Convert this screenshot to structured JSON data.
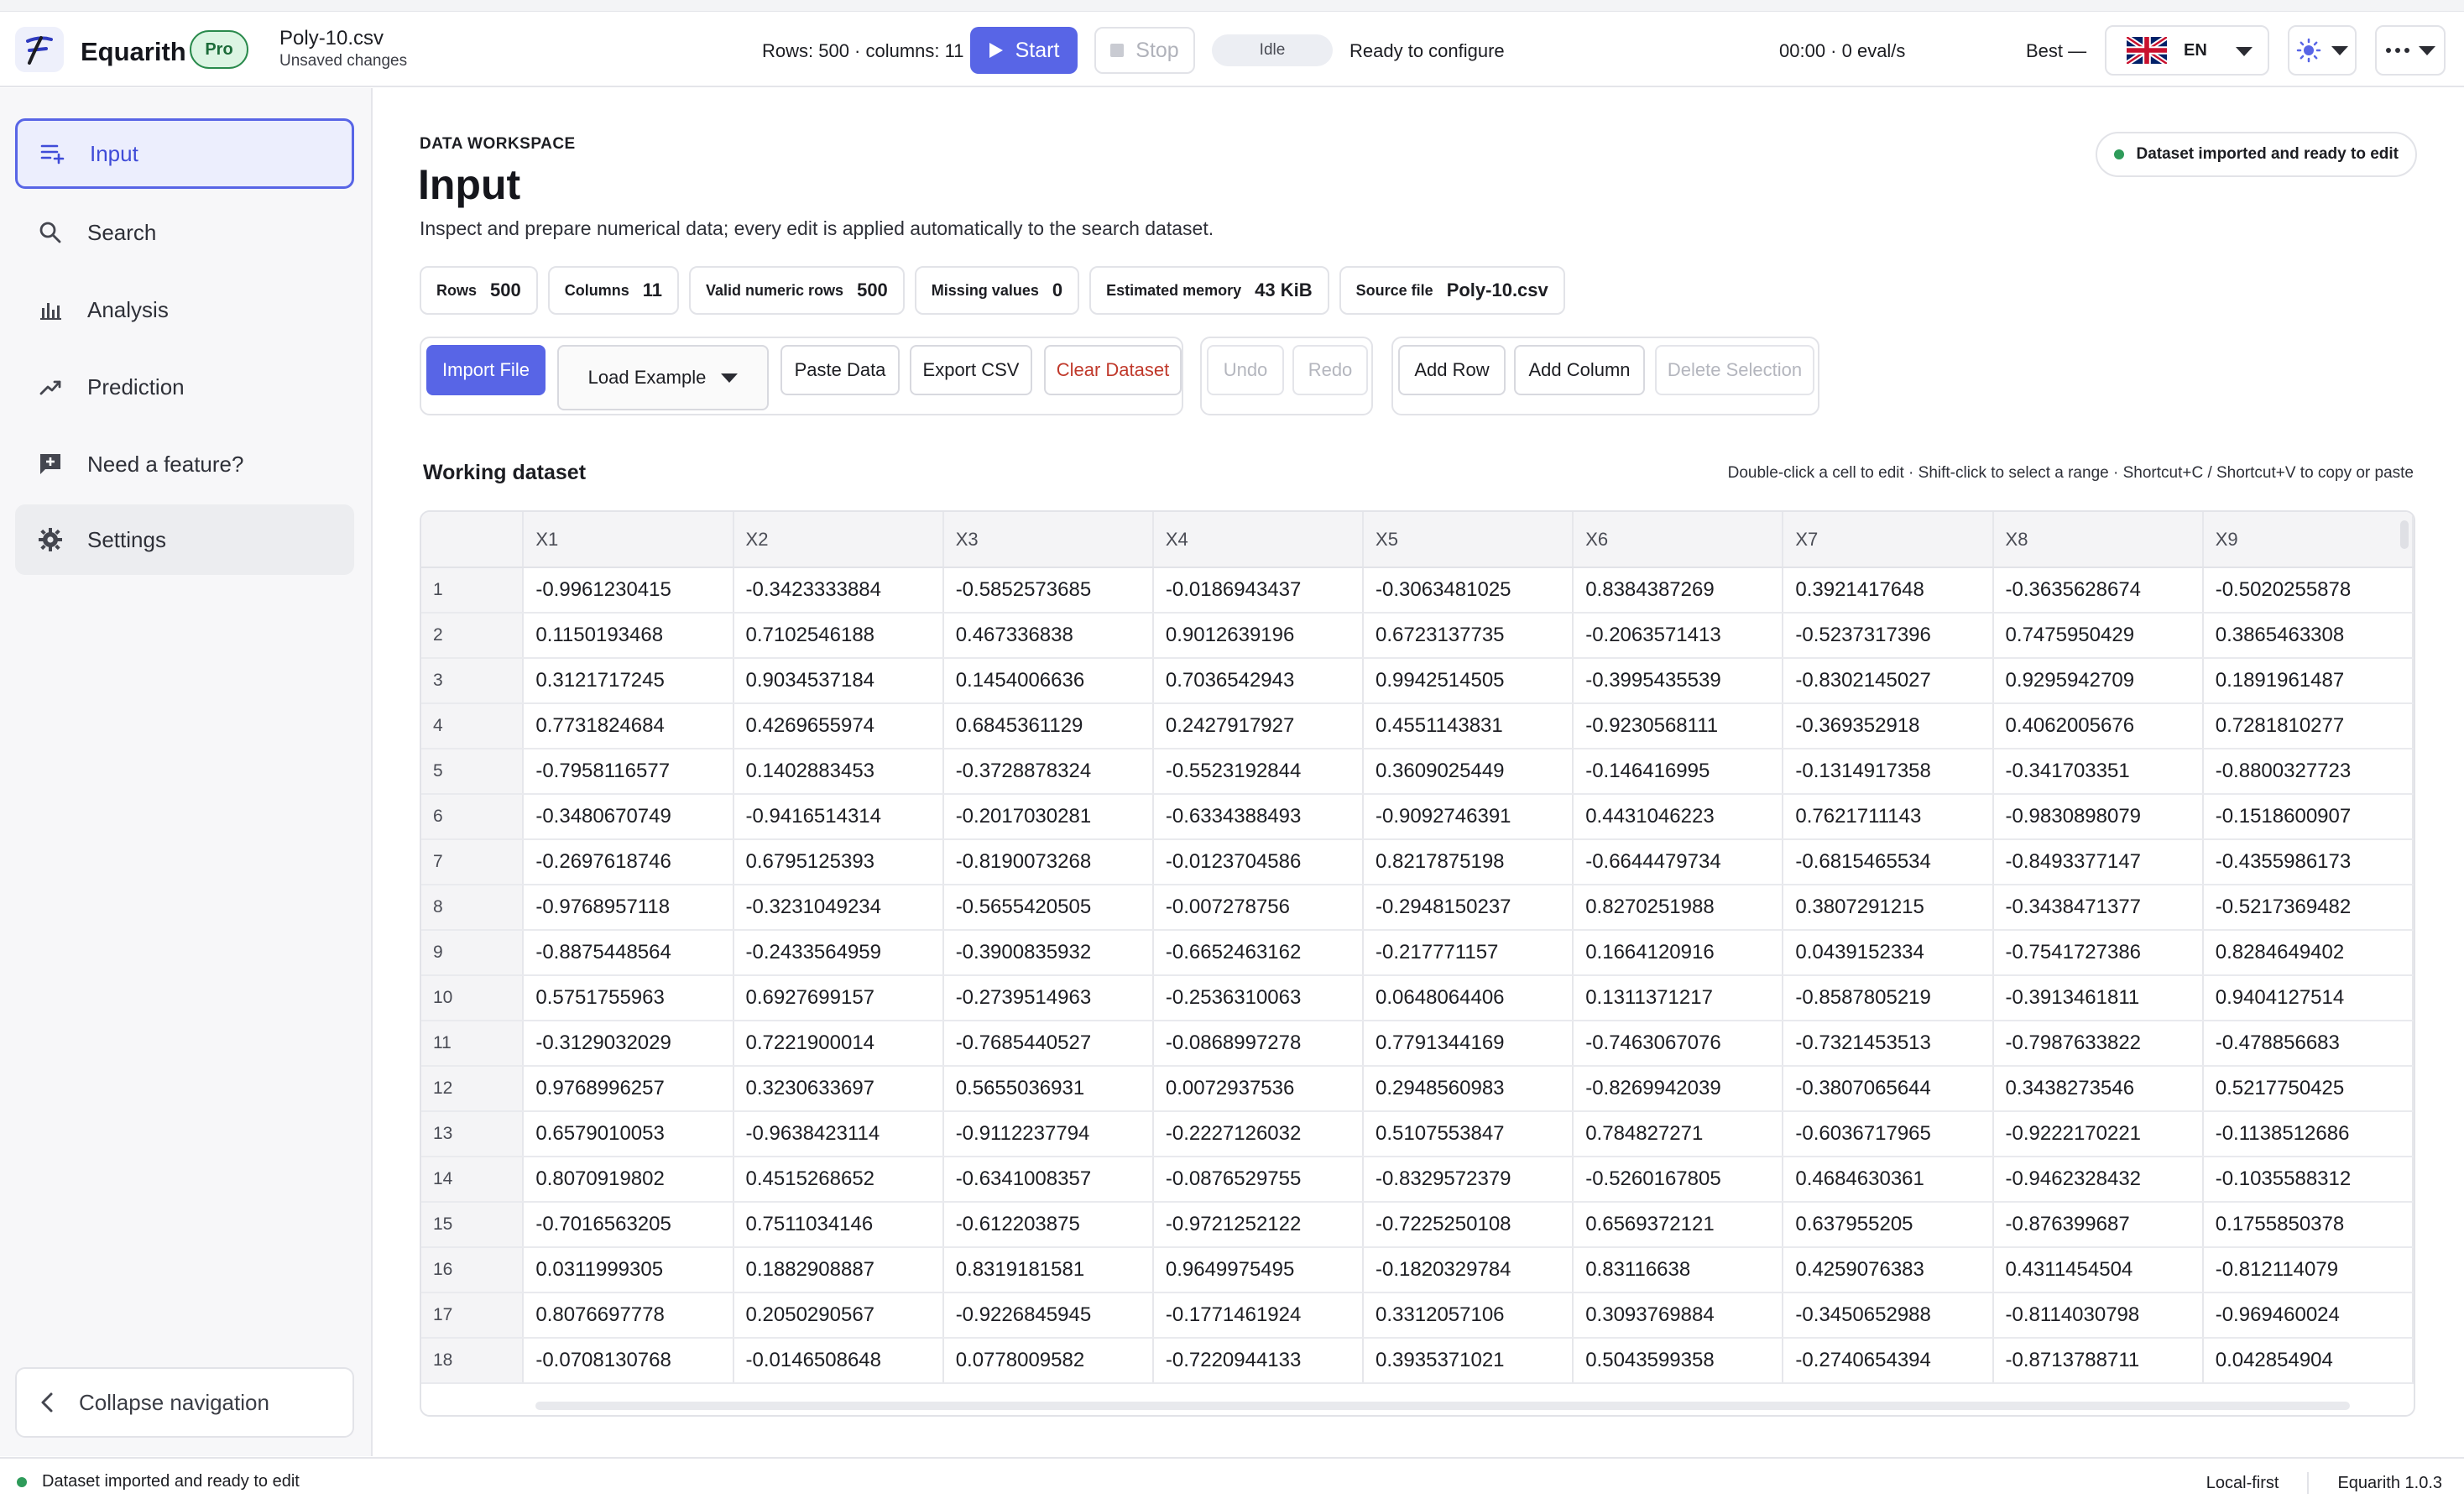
{
  "app": {
    "name": "Equarith",
    "badge": "Pro",
    "file_name": "Poly-10.csv",
    "file_status": "Unsaved changes",
    "version": "Equarith 1.0.3"
  },
  "header": {
    "rows_cols": "Rows: 500 · columns: 11",
    "start_label": "Start",
    "stop_label": "Stop",
    "run_state": "Idle",
    "ready_text": "Ready to configure",
    "timer": "00:00 · 0 eval/s",
    "best": "Best —",
    "language": "EN"
  },
  "sidebar": {
    "items": [
      {
        "label": "Input",
        "icon": "list-add-icon",
        "active": true
      },
      {
        "label": "Search",
        "icon": "search-icon"
      },
      {
        "label": "Analysis",
        "icon": "bar-chart-icon"
      },
      {
        "label": "Prediction",
        "icon": "trend-icon"
      },
      {
        "label": "Need a feature?",
        "icon": "feedback-icon"
      },
      {
        "label": "Settings",
        "icon": "gear-icon"
      }
    ],
    "collapse_label": "Collapse navigation"
  },
  "page": {
    "eyebrow": "DATA WORKSPACE",
    "title": "Input",
    "description": "Inspect and prepare numerical data; every edit is applied automatically to the search dataset.",
    "status_chip": "Dataset imported and ready to edit"
  },
  "stats": [
    {
      "label": "Rows",
      "value": "500"
    },
    {
      "label": "Columns",
      "value": "11"
    },
    {
      "label": "Valid numeric rows",
      "value": "500"
    },
    {
      "label": "Missing values",
      "value": "0"
    },
    {
      "label": "Estimated memory",
      "value": "43 KiB"
    },
    {
      "label": "Source file",
      "value": "Poly-10.csv"
    }
  ],
  "toolbar": {
    "import_file": "Import File",
    "load_example": "Load Example",
    "paste_data": "Paste Data",
    "export_csv": "Export CSV",
    "clear_dataset": "Clear Dataset",
    "undo": "Undo",
    "redo": "Redo",
    "add_row": "Add Row",
    "add_column": "Add Column",
    "delete_selection": "Delete Selection"
  },
  "workspace": {
    "title": "Working dataset",
    "hint": "Double-click a cell to edit · Shift-click to select a range · Shortcut+C / Shortcut+V to copy or paste"
  },
  "table": {
    "columns": [
      "X1",
      "X2",
      "X3",
      "X4",
      "X5",
      "X6",
      "X7",
      "X8",
      "X9"
    ],
    "rows": [
      [
        "1",
        "-0.9961230415",
        "-0.3423333884",
        "-0.5852573685",
        "-0.0186943437",
        "-0.3063481025",
        "0.8384387269",
        "0.3921417648",
        "-0.3635628674",
        "-0.5020255878"
      ],
      [
        "2",
        "0.1150193468",
        "0.7102546188",
        "0.467336838",
        "0.9012639196",
        "0.6723137735",
        "-0.2063571413",
        "-0.5237317396",
        "0.7475950429",
        "0.3865463308"
      ],
      [
        "3",
        "0.3121717245",
        "0.9034537184",
        "0.1454006636",
        "0.7036542943",
        "0.9942514505",
        "-0.3995435539",
        "-0.8302145027",
        "0.9295942709",
        "0.1891961487"
      ],
      [
        "4",
        "0.7731824684",
        "0.4269655974",
        "0.6845361129",
        "0.2427917927",
        "0.4551143831",
        "-0.9230568111",
        "-0.369352918",
        "0.4062005676",
        "0.7281810277"
      ],
      [
        "5",
        "-0.7958116577",
        "0.1402883453",
        "-0.3728878324",
        "-0.5523192844",
        "0.3609025449",
        "-0.146416995",
        "-0.1314917358",
        "-0.341703351",
        "-0.8800327723"
      ],
      [
        "6",
        "-0.3480670749",
        "-0.9416514314",
        "-0.2017030281",
        "-0.6334388493",
        "-0.9092746391",
        "0.4431046223",
        "0.7621711143",
        "-0.9830898079",
        "-0.1518600907"
      ],
      [
        "7",
        "-0.2697618746",
        "0.6795125393",
        "-0.8190073268",
        "-0.0123704586",
        "0.8217875198",
        "-0.6644479734",
        "-0.6815465534",
        "-0.8493377147",
        "-0.4355986173"
      ],
      [
        "8",
        "-0.9768957118",
        "-0.3231049234",
        "-0.5655420505",
        "-0.007278756",
        "-0.2948150237",
        "0.8270251988",
        "0.3807291215",
        "-0.3438471377",
        "-0.5217369482"
      ],
      [
        "9",
        "-0.8875448564",
        "-0.2433564959",
        "-0.3900835932",
        "-0.6652463162",
        "-0.217771157",
        "0.1664120916",
        "0.0439152334",
        "-0.7541727386",
        "0.8284649402"
      ],
      [
        "10",
        "0.5751755963",
        "0.6927699157",
        "-0.2739514963",
        "-0.2536310063",
        "0.0648064406",
        "0.1311371217",
        "-0.8587805219",
        "-0.3913461811",
        "0.9404127514"
      ],
      [
        "11",
        "-0.3129032029",
        "0.7221900014",
        "-0.7685440527",
        "-0.0868997278",
        "0.7791344169",
        "-0.7463067076",
        "-0.7321453513",
        "-0.7987633822",
        "-0.478856683"
      ],
      [
        "12",
        "0.9768996257",
        "0.3230633697",
        "0.5655036931",
        "0.0072937536",
        "0.2948560983",
        "-0.8269942039",
        "-0.3807065644",
        "0.3438273546",
        "0.5217750425"
      ],
      [
        "13",
        "0.6579010053",
        "-0.9638423114",
        "-0.9112237794",
        "-0.2227126032",
        "0.5107553847",
        "0.784827271",
        "-0.6036717965",
        "-0.9222170221",
        "-0.1138512686"
      ],
      [
        "14",
        "0.8070919802",
        "0.4515268652",
        "-0.6341008357",
        "-0.0876529755",
        "-0.8329572379",
        "-0.5260167805",
        "0.4684630361",
        "-0.9462328432",
        "-0.1035588312"
      ],
      [
        "15",
        "-0.7016563205",
        "0.7511034146",
        "-0.612203875",
        "-0.9721252122",
        "-0.7225250108",
        "0.6569372121",
        "0.637955205",
        "-0.876399687",
        "0.1755850378"
      ],
      [
        "16",
        "0.0311999305",
        "0.1882908887",
        "0.8319181581",
        "0.9649975495",
        "-0.1820329784",
        "0.83116638",
        "0.4259076383",
        "0.4311454504",
        "-0.812114079"
      ],
      [
        "17",
        "0.8076697778",
        "0.2050290567",
        "-0.9226845945",
        "-0.1771461924",
        "0.3312057106",
        "0.3093769884",
        "-0.3450652988",
        "-0.8114030798",
        "-0.969460024"
      ],
      [
        "18",
        "-0.0708130768",
        "-0.0146508648",
        "0.0778009582",
        "-0.7220944133",
        "0.3935371021",
        "0.5043599358",
        "-0.2740654394",
        "-0.8713788711",
        "0.042854904"
      ]
    ]
  },
  "footer": {
    "status": "Dataset imported and ready to edit",
    "mode": "Local-first"
  },
  "colors": {
    "accent": "#5865e6",
    "success": "#2e9b5a",
    "danger": "#c0392b"
  }
}
